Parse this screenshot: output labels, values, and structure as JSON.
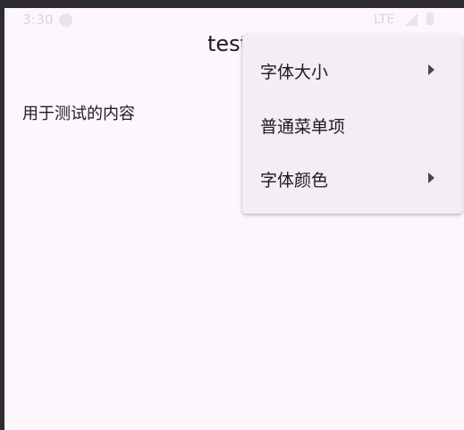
{
  "status_bar": {
    "time": "3:30",
    "network": "LTE",
    "icons": [
      "notification-dot-icon",
      "signal-icon",
      "battery-icon"
    ]
  },
  "app": {
    "title": "test",
    "content_text": "用于测试的内容"
  },
  "menu": {
    "items": [
      {
        "label": "字体大小",
        "has_submenu": true,
        "icon": "submenu-arrow-icon"
      },
      {
        "label": "普通菜单项",
        "has_submenu": false
      },
      {
        "label": "字体颜色",
        "has_submenu": true,
        "icon": "submenu-arrow-icon"
      }
    ]
  },
  "colors": {
    "background": "#fdf7fd",
    "menu_surface": "#f3edf5",
    "text": "#1c1b1f",
    "arrow": "#49454f"
  }
}
